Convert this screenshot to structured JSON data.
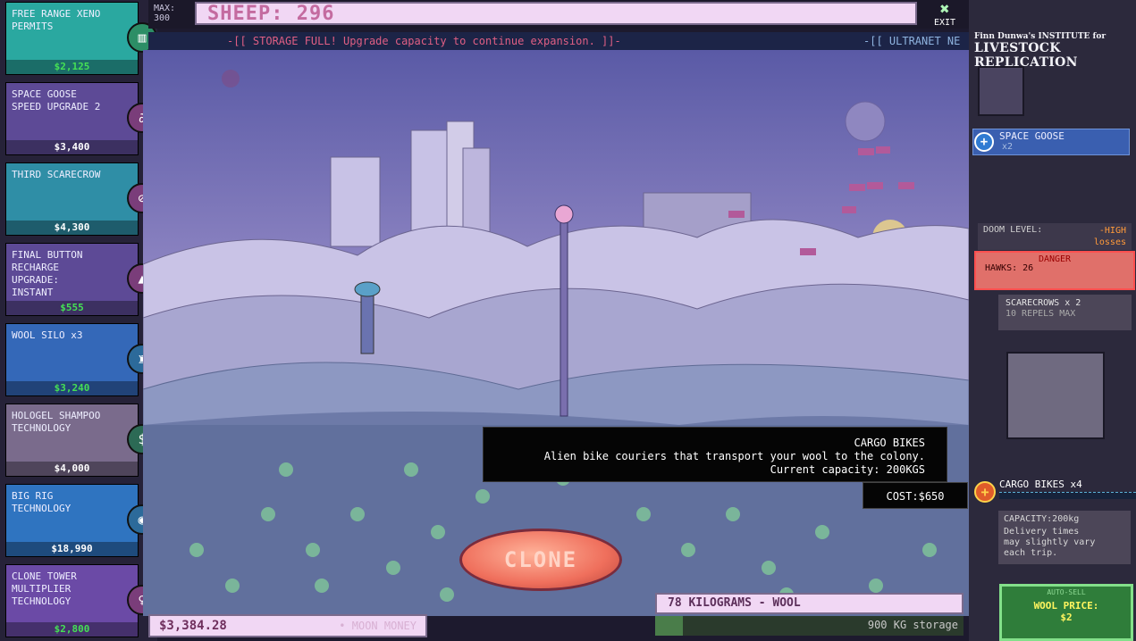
{
  "upgrades": [
    {
      "name": "FREE RANGE XENO\nPERMITS",
      "price": "$2,125",
      "price_color": "green",
      "icon": "gate-icon",
      "bg": "#2aa8a0",
      "icon_bg": "#2c8e66"
    },
    {
      "name": "SPACE GOOSE\nSPEED UPGRADE 2",
      "price": "$3,400",
      "price_color": "white",
      "icon": "goose-icon",
      "bg": "#5d4a96",
      "icon_bg": "#7a3d7a"
    },
    {
      "name": "THIRD SCARECROW",
      "price": "$4,300",
      "price_color": "white",
      "icon": "no-icon",
      "bg": "#2f8ea6",
      "icon_bg": "#7a3d7a"
    },
    {
      "name": "FINAL BUTTON\nRECHARGE\nUPGRADE:\nINSTANT",
      "price": "$555",
      "price_color": "green",
      "icon": "alarm-icon",
      "bg": "#5d4a96",
      "icon_bg": "#7a3d7a"
    },
    {
      "name": "WOOL SILO x3",
      "price": "$3,240",
      "price_color": "green",
      "icon": "silo-icon",
      "bg": "#3468b8",
      "icon_bg": "#2c6a9a"
    },
    {
      "name": "HOLOGEL SHAMPOO\nTECHNOLOGY",
      "price": "$4,000",
      "price_color": "white",
      "icon": "dollar-icon",
      "bg": "#7a6b8c",
      "icon_bg": "#2c6a55"
    },
    {
      "name": "BIG RIG\nTECHNOLOGY",
      "price": "$18,990",
      "price_color": "white",
      "icon": "ufo-icon",
      "bg": "#2f74c0",
      "icon_bg": "#2c6a9a"
    },
    {
      "name": "CLONE TOWER\nMULTIPLIER\nTECHNOLOGY",
      "price": "$2,800",
      "price_color": "green",
      "icon": "tower-icon",
      "bg": "#6b4aa6",
      "icon_bg": "#7a3d7a"
    }
  ],
  "top": {
    "max_label": "MAX:",
    "max_value": "300",
    "sheep_label": "SHEEP: 296",
    "exit_label": "EXIT"
  },
  "ticker": {
    "message": "-[[  STORAGE FULL! Upgrade capacity to continue expansion. ]]-",
    "message2": "-[[ ULTRANET NE"
  },
  "tooltip": {
    "title": "CARGO BIKES",
    "line1": "Alien bike couriers that transport your wool to the colony.",
    "line2": "Current capacity: 200KGS",
    "cost": "COST:$650"
  },
  "clone_label": "CLONE",
  "money": {
    "value": "$3,384.28",
    "label": "• MOON MONEY"
  },
  "wool": {
    "label": "78 KILOGRAMS - WOOL"
  },
  "storage": {
    "text": "900 KG storage",
    "percent": "9%",
    "fill_fraction": 0.09
  },
  "institute": {
    "line1": "Finn Dunwa's INSTITUTE for",
    "line2": "LIVESTOCK REPLICATION"
  },
  "right": {
    "goose_name": "SPACE GOOSE",
    "goose_count": "x2",
    "doom_label": "DOOM LEVEL:",
    "doom_value": "-HIGH",
    "doom_sub": "losses",
    "danger_title": "DANGER",
    "hawks": "HAWKS: 26",
    "scare_title": "SCARECROWS x 2",
    "scare_sub": "10 REPELS MAX",
    "cargo_name": "CARGO BIKES x4",
    "cargo_capacity": "CAPACITY:200kg",
    "cargo_desc": "Delivery times\nmay slightly vary\neach trip.",
    "auto_sell": "AUTO-SELL",
    "wool_price_label": "WOOL PRICE:",
    "wool_price": "$2"
  }
}
